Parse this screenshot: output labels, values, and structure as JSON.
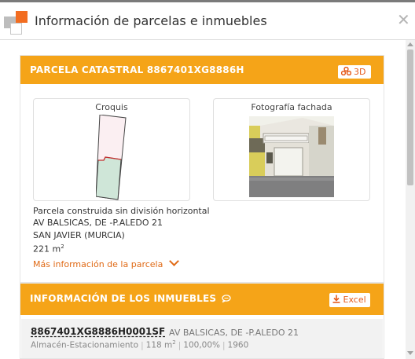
{
  "window": {
    "title": "Información de parcelas e inmuebles"
  },
  "parcela": {
    "header": "PARCELA CATASTRAL 8867401XG8886H",
    "btn_3d": "3D",
    "croquis_title": "Croquis",
    "foto_title": "Fotografía fachada",
    "line1": "Parcela construida sin división horizontal",
    "line2": "AV BALSICAS, DE -P.ALEDO 21",
    "line3": "SAN JAVIER (MURCIA)",
    "superficie": "221 m",
    "superficie_exp": "2",
    "more_link": "Más información de la parcela"
  },
  "inmuebles": {
    "header": "INFORMACIÓN DE LOS INMUEBLES",
    "btn_excel": "Excel",
    "rows": [
      {
        "ref": "8867401XG8886H0001SF",
        "addr": "AV BALSICAS, DE -P.ALEDO 21",
        "uso": "Almacén-Estacionamiento",
        "sup": "118 m",
        "sup_exp": "2",
        "pct": "100,00%",
        "year": "1960"
      }
    ]
  },
  "colors": {
    "accent": "#f5a418",
    "link": "#e06a16"
  },
  "icons": [
    "close-icon",
    "3d-icon",
    "download-icon",
    "comment-icon",
    "chevron-down-icon"
  ]
}
